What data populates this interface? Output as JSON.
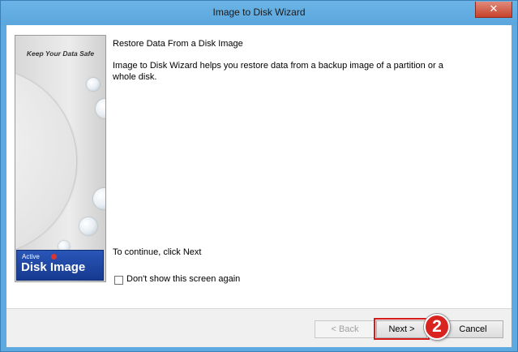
{
  "window": {
    "title": "Image to Disk Wizard",
    "close_glyph": "✕"
  },
  "side_panel": {
    "tagline": "Keep Your Data Safe",
    "logo_small": "Active",
    "logo_big": "Disk Image"
  },
  "content": {
    "heading": "Restore Data From a Disk Image",
    "description": "Image to Disk Wizard helps you restore data from a backup image of a partition or a whole disk.",
    "continue_text": "To continue, click Next",
    "checkbox_label": "Don't show this screen again",
    "checkbox_checked": false
  },
  "buttons": {
    "back_label": "< Back",
    "next_label": "Next >",
    "cancel_label": "Cancel"
  },
  "callout": {
    "number": "2",
    "color": "#d8231f"
  },
  "colors": {
    "title_bar": "#5eaae0",
    "close_button": "#c7422b",
    "highlight_border": "#d71a1a",
    "logo_blue": "#1e4aa8"
  }
}
